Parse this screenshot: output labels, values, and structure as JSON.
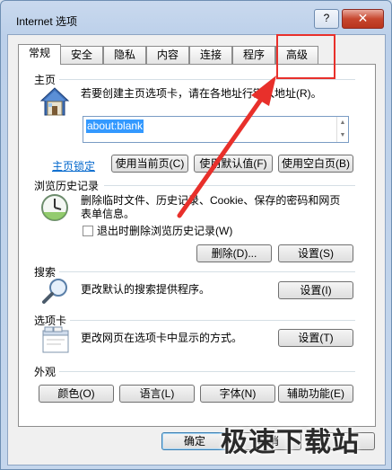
{
  "window": {
    "title": "Internet 选项",
    "help_label": "?",
    "close_label": "✕"
  },
  "tabs": [
    {
      "label": "常规"
    },
    {
      "label": "安全"
    },
    {
      "label": "隐私"
    },
    {
      "label": "内容"
    },
    {
      "label": "连接"
    },
    {
      "label": "程序"
    },
    {
      "label": "高级"
    }
  ],
  "homepage": {
    "group_title": "主页",
    "description": "若要创建主页选项卡，请在各地址行键入地址(R)。",
    "url_value": "about:blank",
    "link_label": "主页锁定",
    "btn_current": "使用当前页(C)",
    "btn_default": "使用默认值(F)",
    "btn_blank": "使用空白页(B)"
  },
  "history": {
    "group_title": "浏览历史记录",
    "description": "删除临时文件、历史记录、Cookie、保存的密码和网页表单信息。",
    "checkbox_label": "退出时删除浏览历史记录(W)",
    "btn_delete": "删除(D)...",
    "btn_settings": "设置(S)"
  },
  "search": {
    "group_title": "搜索",
    "description": "更改默认的搜索提供程序。",
    "btn_settings": "设置(I)"
  },
  "tabs_group": {
    "group_title": "选项卡",
    "description": "更改网页在选项卡中显示的方式。",
    "btn_settings": "设置(T)"
  },
  "appearance": {
    "group_title": "外观",
    "btn_colors": "颜色(O)",
    "btn_languages": "语言(L)",
    "btn_fonts": "字体(N)",
    "btn_accessibility": "辅助功能(E)"
  },
  "footer": {
    "ok": "确定",
    "cancel": "取消"
  },
  "watermark": "极速下载站",
  "colors": {
    "highlight": "#e8302b",
    "link": "#0066cc",
    "selection": "#3399ff"
  }
}
